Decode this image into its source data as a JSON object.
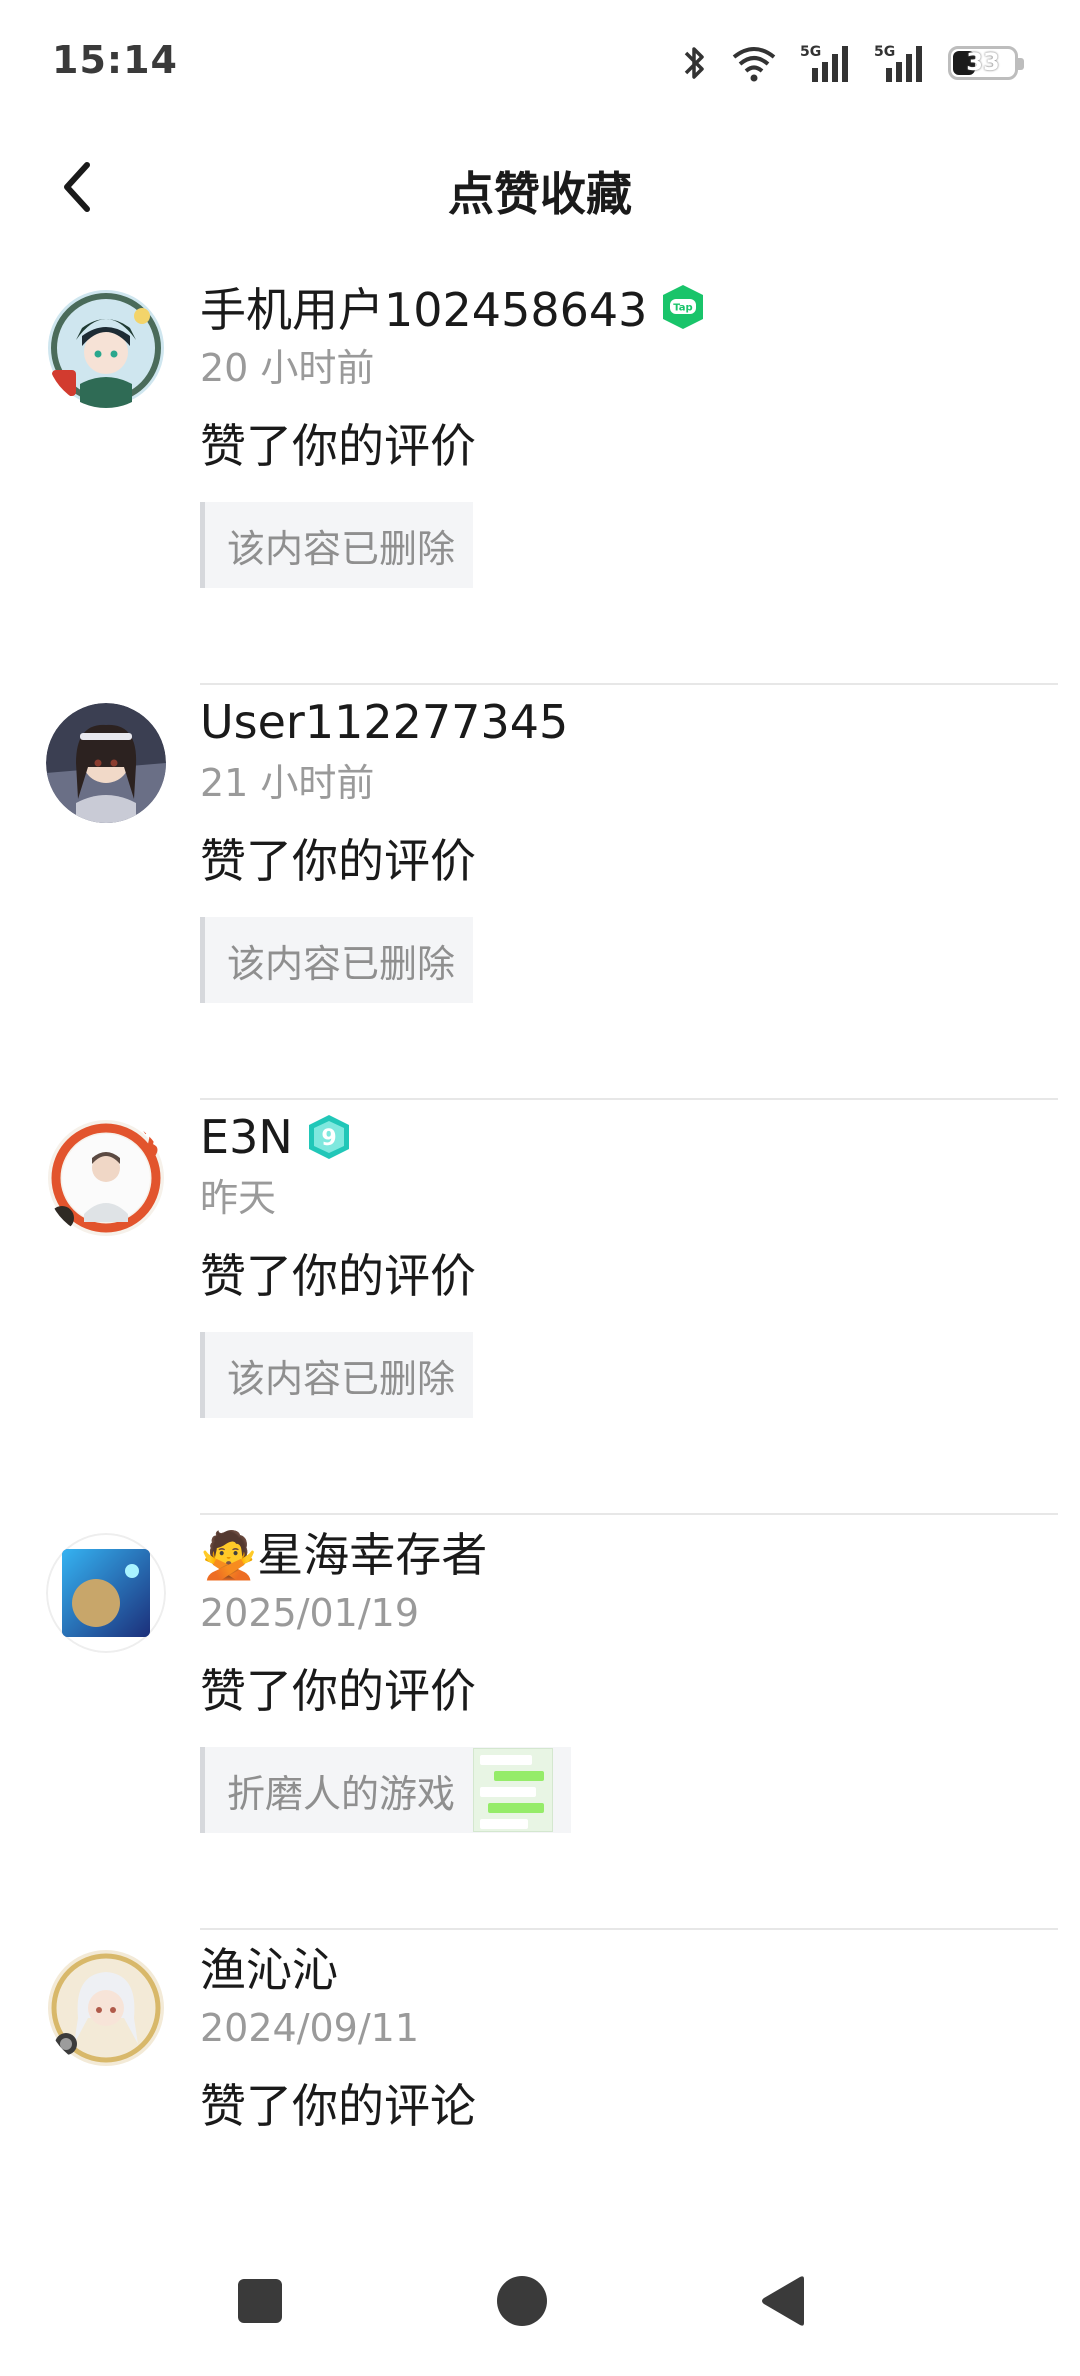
{
  "status": {
    "time": "15:14",
    "battery": "33"
  },
  "header": {
    "title": "点赞收藏"
  },
  "items": [
    {
      "username": "手机用户102458643",
      "time": "20 小时前",
      "action": "赞了你的评价",
      "quote": "该内容已删除",
      "badge": "tap-badge-icon"
    },
    {
      "username": "User112277345",
      "time": "21 小时前",
      "action": "赞了你的评价",
      "quote": "该内容已删除"
    },
    {
      "username": "E3N",
      "time": "昨天",
      "action": "赞了你的评价",
      "quote": "该内容已删除",
      "badge": "level-9-badge-icon"
    },
    {
      "username": "🙅星海幸存者",
      "time": "2025/01/19",
      "action": "赞了你的评价",
      "quote": "折磨人的游戏",
      "thumbnail": "chat-screenshot-thumbnail"
    },
    {
      "username": "渔沁沁",
      "time": "2024/09/11",
      "action": "赞了你的评论"
    }
  ],
  "colors": {
    "tap_green": "#19c46a",
    "teal_badge": "#21c7b8",
    "muted": "#9a9a9a"
  }
}
